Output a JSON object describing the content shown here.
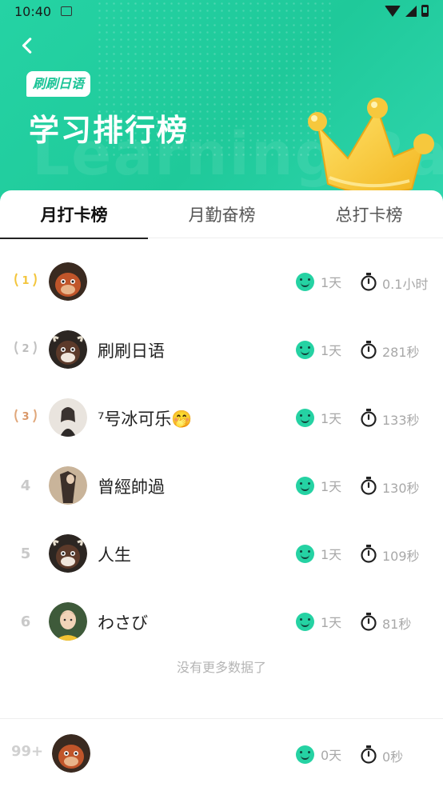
{
  "status_bar": {
    "time": "10:40"
  },
  "header": {
    "brand": "刷刷日语",
    "title": "学习排行榜",
    "watermark": "Learning Rank"
  },
  "tabs": [
    {
      "label": "月打卡榜",
      "active": true
    },
    {
      "label": "月勤奋榜",
      "active": false
    },
    {
      "label": "总打卡榜",
      "active": false
    }
  ],
  "colors": {
    "accent": "#25d2a3",
    "gold": "#f3c53c",
    "silver": "#c0c0c0",
    "bronze": "#e0a77a"
  },
  "rankings": [
    {
      "rank": "1",
      "name": "",
      "days": "1天",
      "time": "0.1小时",
      "avatar": "cartoon-bull-red"
    },
    {
      "rank": "2",
      "name": "刷刷日语",
      "days": "1天",
      "time": "281秒",
      "avatar": "cartoon-bull-dark"
    },
    {
      "rank": "3",
      "name": "⁷号冰可乐🤭",
      "days": "1天",
      "time": "133秒",
      "avatar": "person-photo-light"
    },
    {
      "rank": "4",
      "name": "曾經帥過",
      "days": "1天",
      "time": "130秒",
      "avatar": "person-photo-dark"
    },
    {
      "rank": "5",
      "name": "人生",
      "days": "1天",
      "time": "109秒",
      "avatar": "cartoon-bull-dark"
    },
    {
      "rank": "6",
      "name": "わさび",
      "days": "1天",
      "time": "81秒",
      "avatar": "cartoon-man"
    }
  ],
  "no_more_text": "没有更多数据了",
  "my_rank": {
    "rank": "99+",
    "days": "0天",
    "time": "0秒"
  }
}
